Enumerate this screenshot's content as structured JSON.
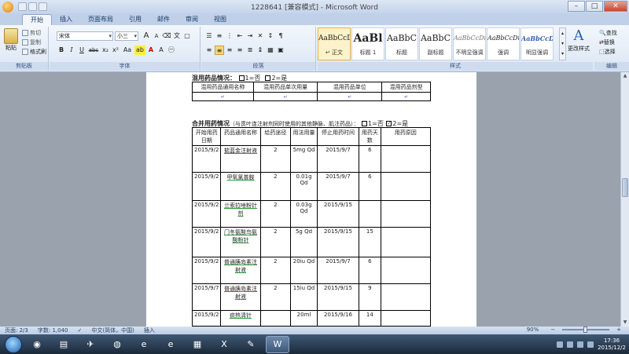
{
  "window": {
    "title": "1228641 [兼容模式] - Microsoft Word",
    "minimize": "–",
    "maximize": "□",
    "close": "✕"
  },
  "tabs": [
    "开始",
    "插入",
    "页面布局",
    "引用",
    "邮件",
    "审阅",
    "视图"
  ],
  "ribbon": {
    "clipboard": {
      "paste": "粘贴",
      "cut": "剪切",
      "copy": "复制",
      "format_painter": "格式刷",
      "label": "剪贴板"
    },
    "font": {
      "name": "宋体",
      "size": "小三",
      "grow": "A",
      "shrink": "A",
      "label": "字体",
      "bold": "B",
      "italic": "I",
      "underline": "U",
      "strike": "abc",
      "subscript": "x₂",
      "superscript": "x²",
      "case": "Aa",
      "highlight": "ab",
      "color": "A"
    },
    "paragraph": {
      "label": "段落"
    },
    "styles": {
      "label": "样式",
      "items": [
        {
          "sample": "AaBbCcDc",
          "name": "↵ 正文"
        },
        {
          "sample": "AaBl",
          "name": "标题 1"
        },
        {
          "sample": "AaBbC",
          "name": "标题"
        },
        {
          "sample": "AaBbC",
          "name": "副标题"
        },
        {
          "sample": "AaBbCcDt",
          "name": "不明显强调"
        },
        {
          "sample": "AaBbCcDt",
          "name": "强调"
        },
        {
          "sample": "AaBbCcDt",
          "name": "明显强调"
        }
      ],
      "change_styles": "更改样式"
    },
    "editing": {
      "label": "编辑",
      "find": "查找",
      "replace": "替换",
      "select": "选择"
    }
  },
  "document": {
    "section1": {
      "title": "混用药品情况：",
      "opt1": "1=否",
      "opt2": "2=是",
      "headers": [
        "混用药品通用名称",
        "混用药品单次用量",
        "混用药品单位",
        "混用药品剂型"
      ]
    },
    "section2": {
      "title": "合并用药情况",
      "subtitle": "（与贯叶连注射剂同时使用的其他静脉、肌注药品）：",
      "opt1": "1=否",
      "opt2": "2=是",
      "headers": [
        "开始用药日期",
        "药品通用名称",
        "给药途径",
        "用法用量",
        "停止用药时间",
        "用药天数",
        "用药原因"
      ],
      "rows": [
        {
          "start": "2015/9/2",
          "name": "掂蓝金注射液",
          "route": "2",
          "dose": "5mg Qd",
          "stop": "2015/9/7",
          "days": "6",
          "reason": ""
        },
        {
          "start": "2015/9/2",
          "name": "甲氧氯普胺",
          "route": "2",
          "dose": "0.01g Qd",
          "stop": "2015/9/7",
          "days": "6",
          "reason": ""
        },
        {
          "start": "2015/9/2",
          "name": "兰索拉唑粉针剂",
          "route": "2",
          "dose": "0.03g Qd",
          "stop": "2015/9/15",
          "days": "",
          "reason": ""
        },
        {
          "start": "2015/9/2",
          "name": "门冬氨酸鸟氨酸粉针",
          "route": "2",
          "dose": "5g Qd",
          "stop": "2015/9/15",
          "days": "15",
          "reason": ""
        },
        {
          "start": "2015/9/2",
          "name": "普通胰岛素注射液",
          "route": "2",
          "dose": "20iu Qd",
          "stop": "2015/9/7",
          "days": "6",
          "reason": ""
        },
        {
          "start": "2015/9/7",
          "name": "普通胰岛素注射液",
          "route": "2",
          "dose": "15iu Qd",
          "stop": "2015/9/15",
          "days": "9",
          "reason": ""
        },
        {
          "start": "2015/9/2",
          "name": "痰热清针",
          "route": "",
          "dose": "20ml",
          "stop": "2015/9/16",
          "days": "14",
          "reason": ""
        }
      ]
    }
  },
  "status": {
    "page": "页面: 2/3",
    "words": "字数: 1,040",
    "language": "中文(简体，中国)",
    "insert": "插入",
    "zoom": "90%",
    "zoom_value": 90
  },
  "taskbar": {
    "time": "17:36",
    "date": "2015/12/2"
  }
}
